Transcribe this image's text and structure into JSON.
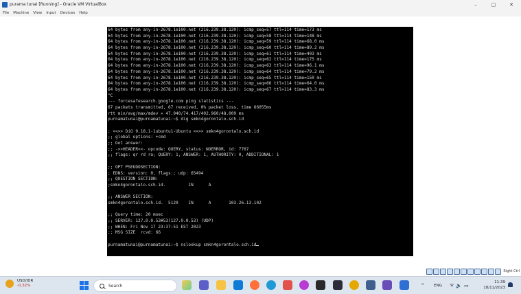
{
  "window": {
    "title": "purama tunai [Running] - Oracle VM VirtualBox",
    "minimize": "–",
    "maximize": "▢",
    "close": "✕"
  },
  "menu": [
    "File",
    "Machine",
    "View",
    "Input",
    "Devices",
    "Help"
  ],
  "terminal": {
    "lines": [
      "64 bytes from any-in-2678.1e100.net (216.239.38.120): icmp_seq=57 ttl=114 time=173 ms",
      "64 bytes from any-in-2678.1e100.net (216.239.38.120): icmp_seq=58 ttl=114 time=148 ms",
      "64 bytes from any-in-2678.1e100.net (216.239.38.120): icmp_seq=59 ttl=114 time=68.0 ms",
      "64 bytes from any-in-2678.1e100.net (216.239.38.120): icmp_seq=60 ttl=114 time=89.2 ms",
      "64 bytes from any-in-2678.1e100.net (216.239.38.120): icmp_seq=61 ttl=114 time=403 ms",
      "64 bytes from any-in-2678.1e100.net (216.239.38.120): icmp_seq=62 ttl=114 time=175 ms",
      "64 bytes from any-in-2678.1e100.net (216.239.38.120): icmp_seq=63 ttl=114 time=96.1 ms",
      "64 bytes from any-in-2678.1e100.net (216.239.38.120): icmp_seq=64 ttl=114 time=79.2 ms",
      "64 bytes from any-in-2678.1e100.net (216.239.38.120): icmp_seq=65 ttl=114 time=150 ms",
      "64 bytes from any-in-2678.1e100.net (216.239.38.120): icmp_seq=66 ttl=114 time=64.0 ms",
      "64 bytes from any-in-2678.1e100.net (216.239.38.120): icmp_seq=67 ttl=114 time=83.3 ms",
      "^C",
      "--- forcesafesearch.google.com ping statistics ---",
      "67 packets transmitted, 67 received, 0% packet loss, time 66055ms",
      "rtt min/avg/max/mdev = 47.940/74.417/402.960/48.009 ms",
      "purnamatunai@purnamatunai:~$ dig smkn4gorontalo.sch.id",
      "",
      "; <<>> DiG 9.18.1-1ubuntu1-Ubuntu <<>> smkn4gorontalo.sch.id",
      ";; global options: +cmd",
      ";; Got answer:",
      ";; ->>HEADER<<- opcode: QUERY, status: NOERROR, id: 7767",
      ";; flags: qr rd ra; QUERY: 1, ANSWER: 1, AUTHORITY: 0, ADDITIONAL: 1",
      "",
      ";; OPT PSEUDOSECTION:",
      "; EDNS: version: 0, flags:; udp: 65494",
      ";; QUESTION SECTION:",
      ";smkn4gorontalo.sch.id.         IN      A",
      "",
      ";; ANSWER SECTION:",
      "smkn4gorontalo.sch.id.  5120    IN      A       103.26.13.102",
      "",
      ";; Query time: 20 msec",
      ";; SERVER: 127.0.0.53#53(127.0.0.53) (UDP)",
      ";; WHEN: Fri Nov 17 23:37:51 EST 2023",
      ";; MSG SIZE  rcvd: 66",
      "",
      "purnamatunai@purnamatunai:~$ nslookup smkn4gorontalo.sch.id"
    ]
  },
  "vbox_status": {
    "host_key": "Right Ctrl"
  },
  "taskbar": {
    "weather": {
      "title": "USD/IDR",
      "change": "-0,32%"
    },
    "search_placeholder": "Search",
    "tray": {
      "chevron": "^",
      "lang": "ENG",
      "wifi": "ᯤ",
      "volume": "🔈",
      "battery": "▭"
    },
    "clock": {
      "time": "11:39",
      "date": "18/11/2023"
    }
  }
}
